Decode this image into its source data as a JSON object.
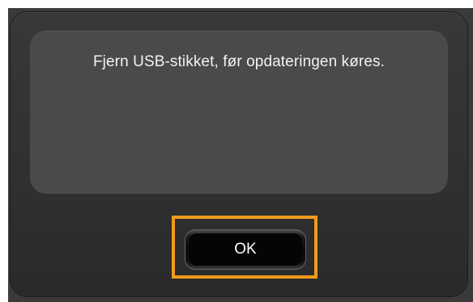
{
  "dialog": {
    "message": "Fjern USB-stikket, før opdateringen køres.",
    "ok_label": "OK"
  },
  "colors": {
    "focus_highlight": "#f39a1e",
    "dialog_background": "#2f2f2f",
    "message_panel": "#4a4a4a",
    "text": "#f2f2f2"
  }
}
